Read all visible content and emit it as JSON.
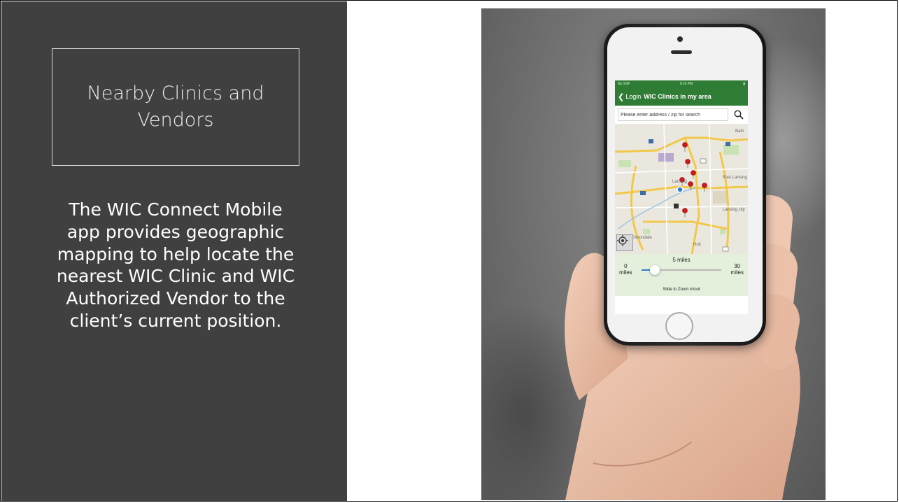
{
  "slide": {
    "title": "Nearby Clinics and Vendors",
    "body": "The WIC Connect Mobile app provides geographic mapping to help locate the nearest WIC Clinic and WIC Authorized Vendor to the client’s current position."
  },
  "app": {
    "status_left": "No SIM",
    "status_time": "9:16 PM",
    "back_label": "Login",
    "screen_title": "WIC Clinics in my area",
    "search_placeholder": "Please enter address / zip for search",
    "map_labels": {
      "lansing": "Lansing",
      "east_lansing": "East Lansing",
      "lansing_city": "Lansing city",
      "dimondale": "Dimondale",
      "holt": "Holt",
      "bath": "Bath"
    },
    "slider": {
      "current_label": "5 miles",
      "min_label_value": "0",
      "min_label_unit": "miles",
      "max_label_value": "30",
      "max_label_unit": "miles",
      "hint": "Slide to Zoom in/out",
      "value_fraction": 0.17
    },
    "colors": {
      "accent_green": "#2f7d34",
      "pin_red": "#d4161c",
      "slider_blue": "#2d7fd3"
    }
  }
}
